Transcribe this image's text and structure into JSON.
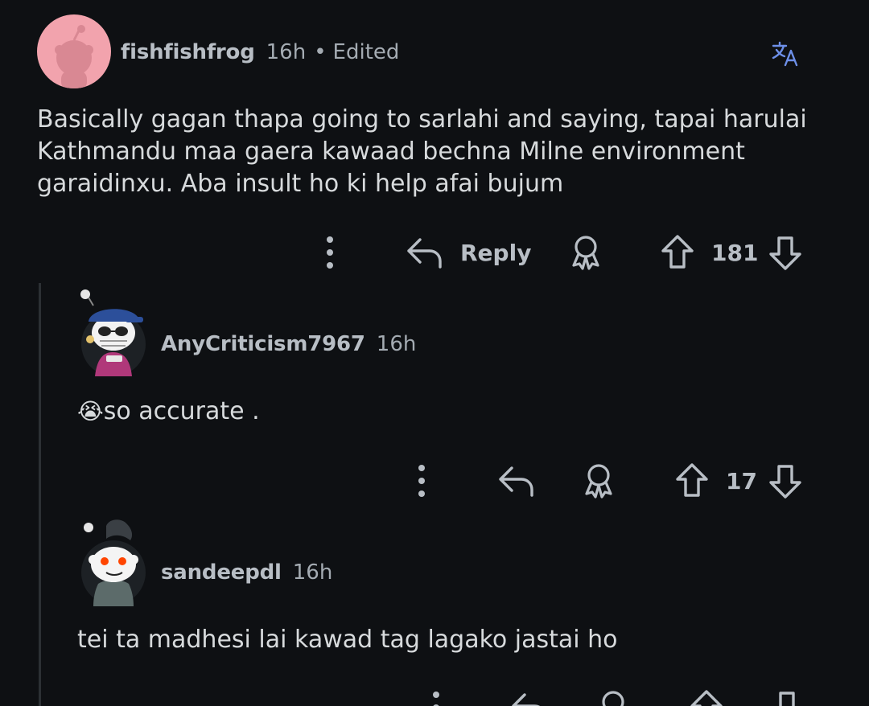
{
  "comments": [
    {
      "username": "fishfishfrog",
      "time": "16h",
      "edited": "Edited",
      "body_lines": [
        "Basically gagan thapa going to sarlahi and saying, tapai harulai",
        "Kathmandu maa gaera kawaad bechna Milne environment",
        "garaidinxu. Aba insult ho ki help afai bujum"
      ],
      "reply_label": "Reply",
      "score": "181",
      "avatar_bg": "#f2a3ad"
    },
    {
      "username": "AnyCriticism7967",
      "time": "16h",
      "emoji": "😭",
      "body": "so accurate .",
      "score": "17"
    },
    {
      "username": "sandeepdl",
      "time": "16h",
      "body": "tei ta madhesi lai kawad tag lagako jastai ho"
    }
  ],
  "translate_icon": "translate-icon",
  "colors": {
    "background": "#0e1013",
    "text": "#d7dadc",
    "muted": "#a4abb2",
    "accent": "#6d8fe8"
  }
}
